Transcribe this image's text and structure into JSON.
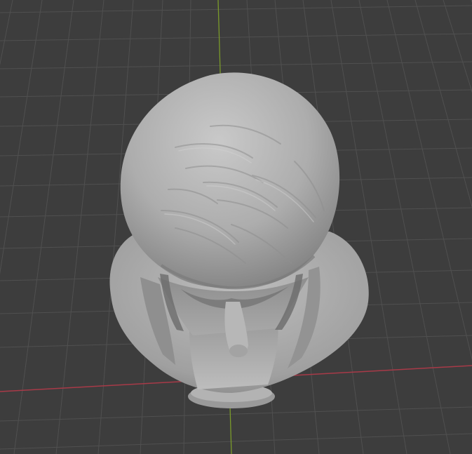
{
  "viewport": {
    "background_color": "#3d3d3d",
    "grid_color": "#4f4f4f",
    "x_axis_color": "#a83a48",
    "y_axis_color": "#7a9a2a",
    "model_base_color": "#a6a6a6",
    "model_shadow_color": "#6a6a6a",
    "model_highlight_color": "#c4c4c4"
  },
  "model": {
    "subject": "sculpted-bust-top-view"
  }
}
